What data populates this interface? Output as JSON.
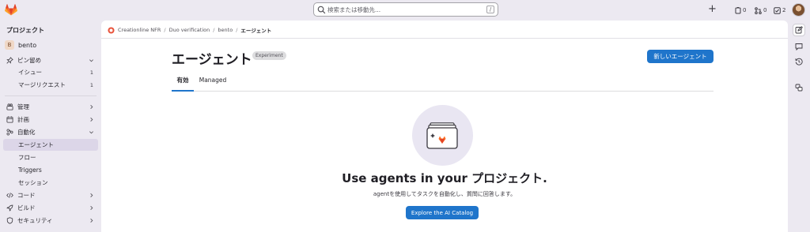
{
  "topbar": {
    "search_placeholder": "検索または移動先...",
    "search_shortcut": "/",
    "plus_label": "+",
    "counts": {
      "issues": "0",
      "merge_requests": "0",
      "todos": "2"
    }
  },
  "sidebar": {
    "header": "プロジェクト",
    "project": {
      "initial": "B",
      "name": "bento"
    },
    "items": [
      {
        "label": "ピン留め",
        "icon": "pin-icon"
      },
      {
        "label": "イシュー",
        "count": "1"
      },
      {
        "label": "マージリクエスト",
        "count": "1"
      },
      {
        "label": "管理",
        "icon": "manage-icon"
      },
      {
        "label": "計画",
        "icon": "plan-icon"
      },
      {
        "label": "自動化",
        "icon": "automate-icon"
      },
      {
        "label": "エージェント"
      },
      {
        "label": "フロー"
      },
      {
        "label": "Triggers"
      },
      {
        "label": "セッション"
      },
      {
        "label": "コード",
        "icon": "code-icon"
      },
      {
        "label": "ビルド",
        "icon": "build-icon"
      },
      {
        "label": "セキュリティ",
        "icon": "shield-icon"
      }
    ]
  },
  "breadcrumb": {
    "items": [
      "Creationline NFR",
      "Duo verification",
      "bento",
      "エージェント"
    ],
    "separator": "/"
  },
  "page": {
    "title": "エージェント",
    "badge": "Experiment",
    "new_button": "新しいエージェント",
    "tabs": [
      "有効",
      "Managed"
    ]
  },
  "empty_state": {
    "title": "Use agents in your プロジェクト.",
    "description": "agentを使用してタスクを自動化し、質問に回答します。",
    "button": "Explore the AI Catalog"
  },
  "colors": {
    "accent": "#1f75cb",
    "sidebar_bg": "#ece9f1",
    "active_nav": "#dcd6e8"
  }
}
